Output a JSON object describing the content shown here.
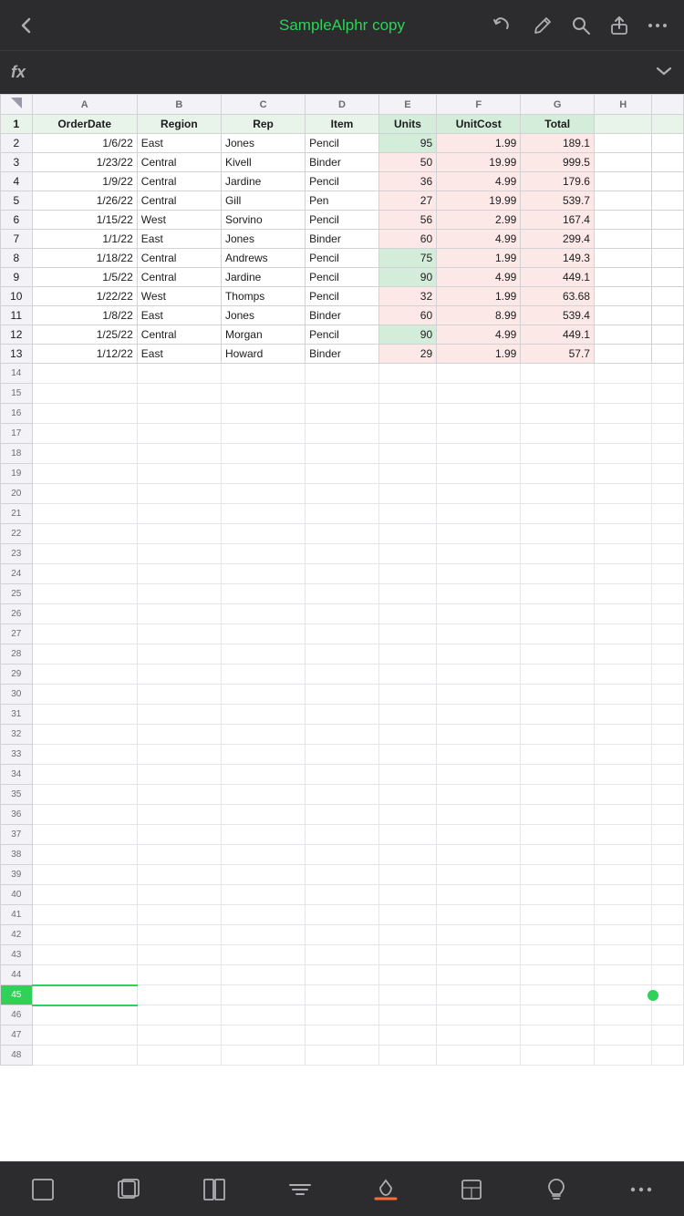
{
  "app": {
    "title": "SampleAlphr copy"
  },
  "toolbar": {
    "back_icon": "‹",
    "undo_icon": "↺",
    "pen_icon": "✏",
    "search_icon": "⌕",
    "share_icon": "⬆",
    "more_icon": "···",
    "formula_icon": "fx",
    "chevron_down": "⌄"
  },
  "spreadsheet": {
    "col_labels": [
      "",
      "A",
      "B",
      "C",
      "D",
      "E",
      "F",
      "G",
      "H",
      ""
    ],
    "header_row": {
      "row_num": "1",
      "a": "OrderDate",
      "b": "Region",
      "c": "Rep",
      "d": "Item",
      "e": "Units",
      "f": "UnitCost",
      "g": "Total"
    },
    "rows": [
      {
        "num": "2",
        "a": "1/6/22",
        "b": "East",
        "c": "Jones",
        "d": "Pencil",
        "e": "95",
        "f": "1.99",
        "g": "189.1",
        "units_type": "green"
      },
      {
        "num": "3",
        "a": "1/23/22",
        "b": "Central",
        "c": "Kivell",
        "d": "Binder",
        "e": "50",
        "f": "19.99",
        "g": "999.5",
        "units_type": "pink"
      },
      {
        "num": "4",
        "a": "1/9/22",
        "b": "Central",
        "c": "Jardine",
        "d": "Pencil",
        "e": "36",
        "f": "4.99",
        "g": "179.6",
        "units_type": "pink"
      },
      {
        "num": "5",
        "a": "1/26/22",
        "b": "Central",
        "c": "Gill",
        "d": "Pen",
        "e": "27",
        "f": "19.99",
        "g": "539.7",
        "units_type": "pink"
      },
      {
        "num": "6",
        "a": "1/15/22",
        "b": "West",
        "c": "Sorvino",
        "d": "Pencil",
        "e": "56",
        "f": "2.99",
        "g": "167.4",
        "units_type": "pink"
      },
      {
        "num": "7",
        "a": "1/1/22",
        "b": "East",
        "c": "Jones",
        "d": "Binder",
        "e": "60",
        "f": "4.99",
        "g": "299.4",
        "units_type": "pink"
      },
      {
        "num": "8",
        "a": "1/18/22",
        "b": "Central",
        "c": "Andrews",
        "d": "Pencil",
        "e": "75",
        "f": "1.99",
        "g": "149.3",
        "units_type": "green"
      },
      {
        "num": "9",
        "a": "1/5/22",
        "b": "Central",
        "c": "Jardine",
        "d": "Pencil",
        "e": "90",
        "f": "4.99",
        "g": "449.1",
        "units_type": "green"
      },
      {
        "num": "10",
        "a": "1/22/22",
        "b": "West",
        "c": "Thomps",
        "d": "Pencil",
        "e": "32",
        "f": "1.99",
        "g": "63.68",
        "units_type": "pink"
      },
      {
        "num": "11",
        "a": "1/8/22",
        "b": "East",
        "c": "Jones",
        "d": "Binder",
        "e": "60",
        "f": "8.99",
        "g": "539.4",
        "units_type": "pink"
      },
      {
        "num": "12",
        "a": "1/25/22",
        "b": "Central",
        "c": "Morgan",
        "d": "Pencil",
        "e": "90",
        "f": "4.99",
        "g": "449.1",
        "units_type": "green"
      },
      {
        "num": "13",
        "a": "1/12/22",
        "b": "East",
        "c": "Howard",
        "d": "Binder",
        "e": "29",
        "f": "1.99",
        "g": "57.7",
        "units_type": "pink"
      }
    ],
    "empty_rows": [
      "14",
      "15",
      "16",
      "17",
      "18",
      "19",
      "20",
      "21",
      "22",
      "23",
      "24",
      "25",
      "26",
      "27",
      "28",
      "29",
      "30",
      "31",
      "32",
      "33",
      "34",
      "35",
      "36",
      "37",
      "38",
      "39",
      "40",
      "41",
      "42",
      "43",
      "44",
      "45",
      "46",
      "47",
      "48"
    ],
    "selected_row": "45"
  },
  "bottom_toolbar": {
    "btn1": "⬜",
    "btn2": "⬚",
    "btn3": "⬛",
    "btn4": "☰",
    "btn5": "⛆",
    "btn6": "⬜",
    "btn7": "💡",
    "btn8": "···"
  }
}
